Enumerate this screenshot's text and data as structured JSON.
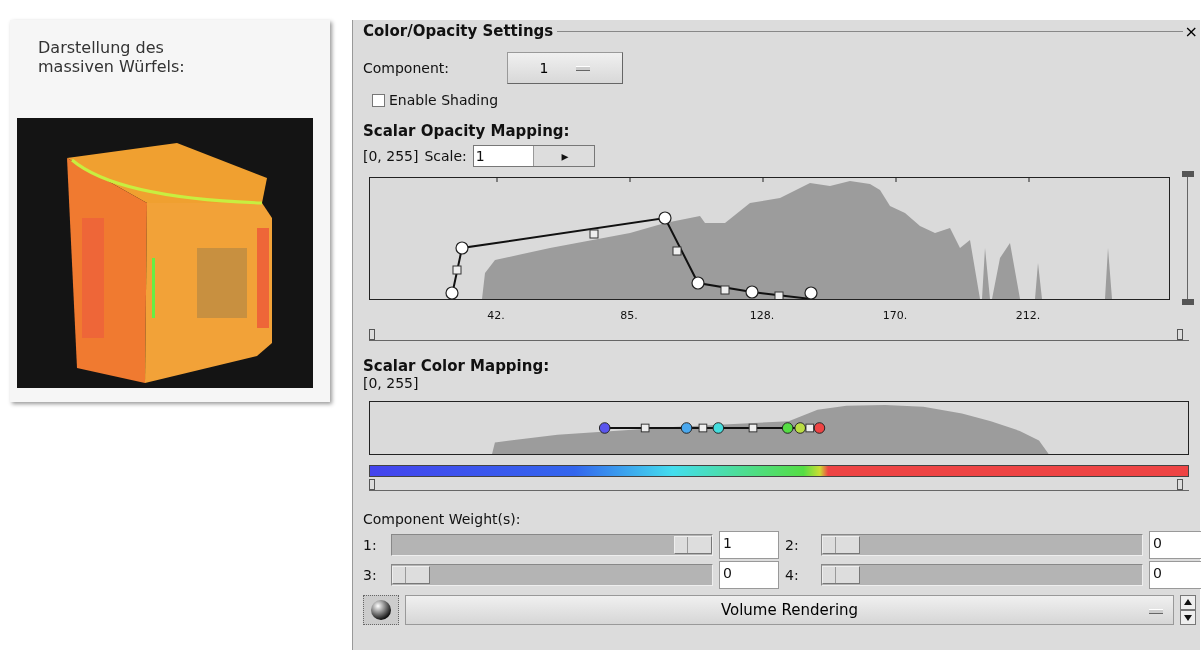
{
  "caption": {
    "text": "Darstellung des massiven Würfels:"
  },
  "panel": {
    "title": "Color/Opacity Settings",
    "close": "×"
  },
  "component": {
    "label": "Component:",
    "value": "1"
  },
  "shading": {
    "label": "Enable Shading",
    "checked": false
  },
  "opacity": {
    "heading": "Scalar Opacity Mapping:",
    "range": "[0, 255]",
    "scale_label": "Scale:",
    "scale_value": "1",
    "scale_arrow": "▸",
    "range_handles": [
      {
        "level": 0
      },
      {
        "level": 1
      }
    ],
    "vertical_range": {
      "level": 1
    },
    "axis_labels": [
      "42.",
      "85.",
      "128.",
      "170.",
      "212."
    ]
  },
  "color": {
    "heading": "Scalar Color Mapping:",
    "range": "[0, 255]",
    "range_handles": [
      {
        "level": 0
      },
      {
        "level": 1
      }
    ]
  },
  "weights": {
    "heading": "Component Weight(s):",
    "items": [
      {
        "label": "1:",
        "level": 1,
        "value": "1"
      },
      {
        "label": "2:",
        "level": 0,
        "value": "0"
      },
      {
        "label": "3:",
        "level": 0,
        "value": "0"
      },
      {
        "label": "4:",
        "level": 0,
        "value": "0"
      }
    ]
  },
  "mode": {
    "value": "Volume Rendering"
  }
}
